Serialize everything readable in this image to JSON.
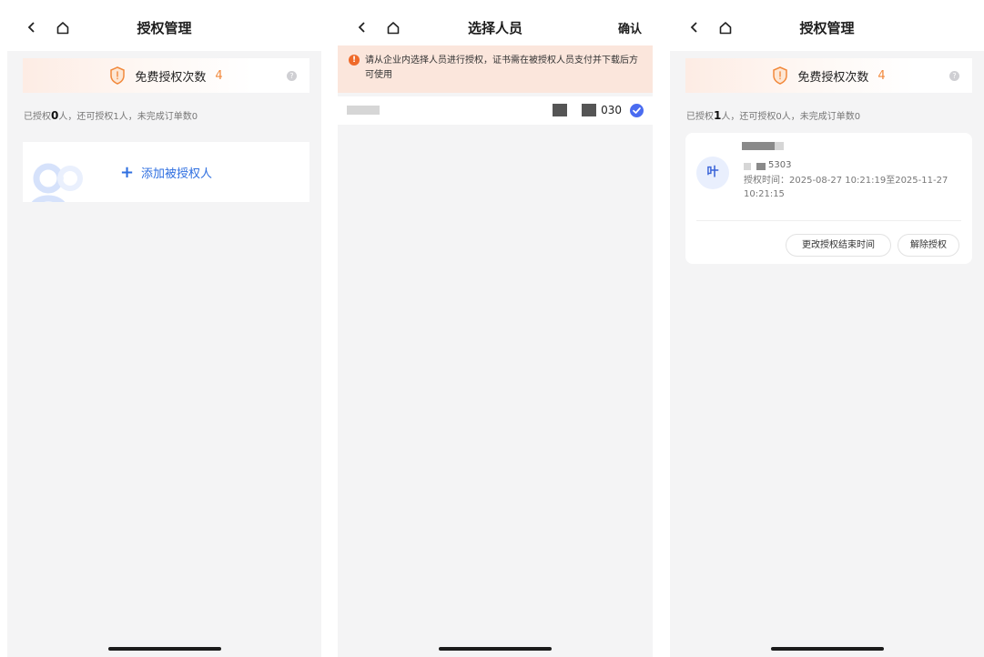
{
  "screens": [
    {
      "title": "授权管理",
      "quota": {
        "label": "免费授权次数",
        "count": "4"
      },
      "summary": {
        "prefix": "已授权",
        "authorized": "0",
        "rest": "人，还可授权1人，未完成订单数0"
      },
      "add_button": {
        "icon": "+",
        "label": "添加被授权人"
      }
    },
    {
      "title": "选择人员",
      "confirm": "确认",
      "notice": "请从企业内选择人员进行授权，证书需在被授权人员支付并下载后方可使用",
      "person": {
        "phone_tail": "030",
        "selected": true
      }
    },
    {
      "title": "授权管理",
      "quota": {
        "label": "免费授权次数",
        "count": "4"
      },
      "summary": {
        "prefix": "已授权",
        "authorized": "1",
        "rest": "人，还可授权0人，未完成订单数0"
      },
      "card": {
        "avatar": "叶",
        "phone_tail": "5303",
        "time": "授权时间：2025-08-27 10:21:19至2025-11-27 10:21:15",
        "change_btn": "更改授权结束时间",
        "revoke_btn": "解除授权"
      }
    }
  ],
  "icons": [
    "back-icon",
    "home-icon",
    "shield-icon",
    "info-icon",
    "plus-icon",
    "warning-icon",
    "check-icon"
  ],
  "colors": {
    "accent_blue": "#2f6fe0",
    "quota_orange": "#f2893c",
    "notice_bg": "#fbe6dc",
    "check_blue": "#4a6cf0"
  }
}
